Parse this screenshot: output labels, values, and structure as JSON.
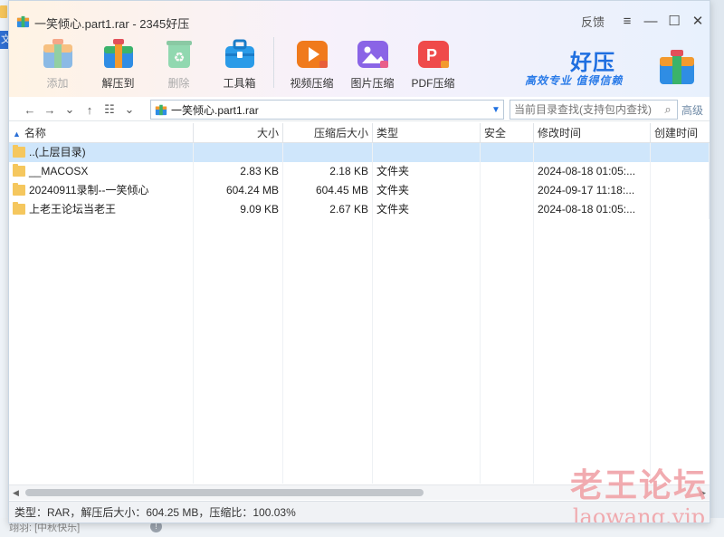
{
  "window": {
    "title": "一笑倾心.part1.rar - 2345好压",
    "feedback_label": "反馈",
    "menu_icon": "hamburger-icon",
    "minimize_icon": "minimize-icon",
    "maximize_icon": "maximize-icon",
    "close_icon": "close-icon"
  },
  "toolbar": {
    "items": [
      {
        "label": "添加",
        "icon": "add-archive-icon",
        "enabled": false,
        "color": "#e86b3a"
      },
      {
        "label": "解压到",
        "icon": "extract-icon",
        "enabled": true,
        "color": "#2a8be0"
      },
      {
        "label": "删除",
        "icon": "recycle-icon",
        "enabled": false,
        "color": "#3cc47c"
      },
      {
        "label": "工具箱",
        "icon": "toolbox-icon",
        "enabled": true,
        "color": "#2a9be8"
      },
      {
        "label": "视频压缩",
        "icon": "video-compress-icon",
        "enabled": true,
        "color": "#f07a1c"
      },
      {
        "label": "图片压缩",
        "icon": "image-compress-icon",
        "enabled": true,
        "color": "#8a64e6"
      },
      {
        "label": "PDF压缩",
        "icon": "pdf-compress-icon",
        "enabled": true,
        "color": "#ef4a4a"
      }
    ]
  },
  "brand": {
    "name": "好压",
    "slogan": "高效专业  值得信赖",
    "color": "#1f6fe0"
  },
  "address": {
    "path": "一笑倾心.part1.rar",
    "search_placeholder": "当前目录查找(支持包内查找)",
    "advanced_label": "高级"
  },
  "columns": [
    {
      "key": "name",
      "label": "名称",
      "align": "left"
    },
    {
      "key": "size",
      "label": "大小",
      "align": "right"
    },
    {
      "key": "packed",
      "label": "压缩后大小",
      "align": "right"
    },
    {
      "key": "type",
      "label": "类型",
      "align": "left"
    },
    {
      "key": "security",
      "label": "安全",
      "align": "left"
    },
    {
      "key": "modified",
      "label": "修改时间",
      "align": "left"
    },
    {
      "key": "created",
      "label": "创建时间",
      "align": "left"
    }
  ],
  "rows": [
    {
      "name": "..(上层目录)",
      "size": "",
      "packed": "",
      "type": "",
      "security": "",
      "modified": "",
      "created": "",
      "selected": true
    },
    {
      "name": "__MACOSX",
      "size": "2.83 KB",
      "packed": "2.18 KB",
      "type": "文件夹",
      "security": "",
      "modified": "2024-08-18 01:05:...",
      "created": "",
      "selected": false
    },
    {
      "name": "20240911录制--一笑倾心",
      "size": "604.24 MB",
      "packed": "604.45 MB",
      "type": "文件夹",
      "security": "",
      "modified": "2024-09-17 11:18:...",
      "created": "",
      "selected": false
    },
    {
      "name": "上老王论坛当老王",
      "size": "9.09 KB",
      "packed": "2.67 KB",
      "type": "文件夹",
      "security": "",
      "modified": "2024-08-18 01:05:...",
      "created": "",
      "selected": false
    }
  ],
  "status": {
    "text": "类型：RAR，解压后大小：604.25 MB，压缩比：100.03%"
  },
  "watermark": {
    "line1": "老王论坛",
    "line2": "laowang.vip"
  },
  "background": {
    "left_tab_text": "文",
    "bottom_text": "翊羽: [中秋快乐]",
    "bottom_btn": "!"
  }
}
